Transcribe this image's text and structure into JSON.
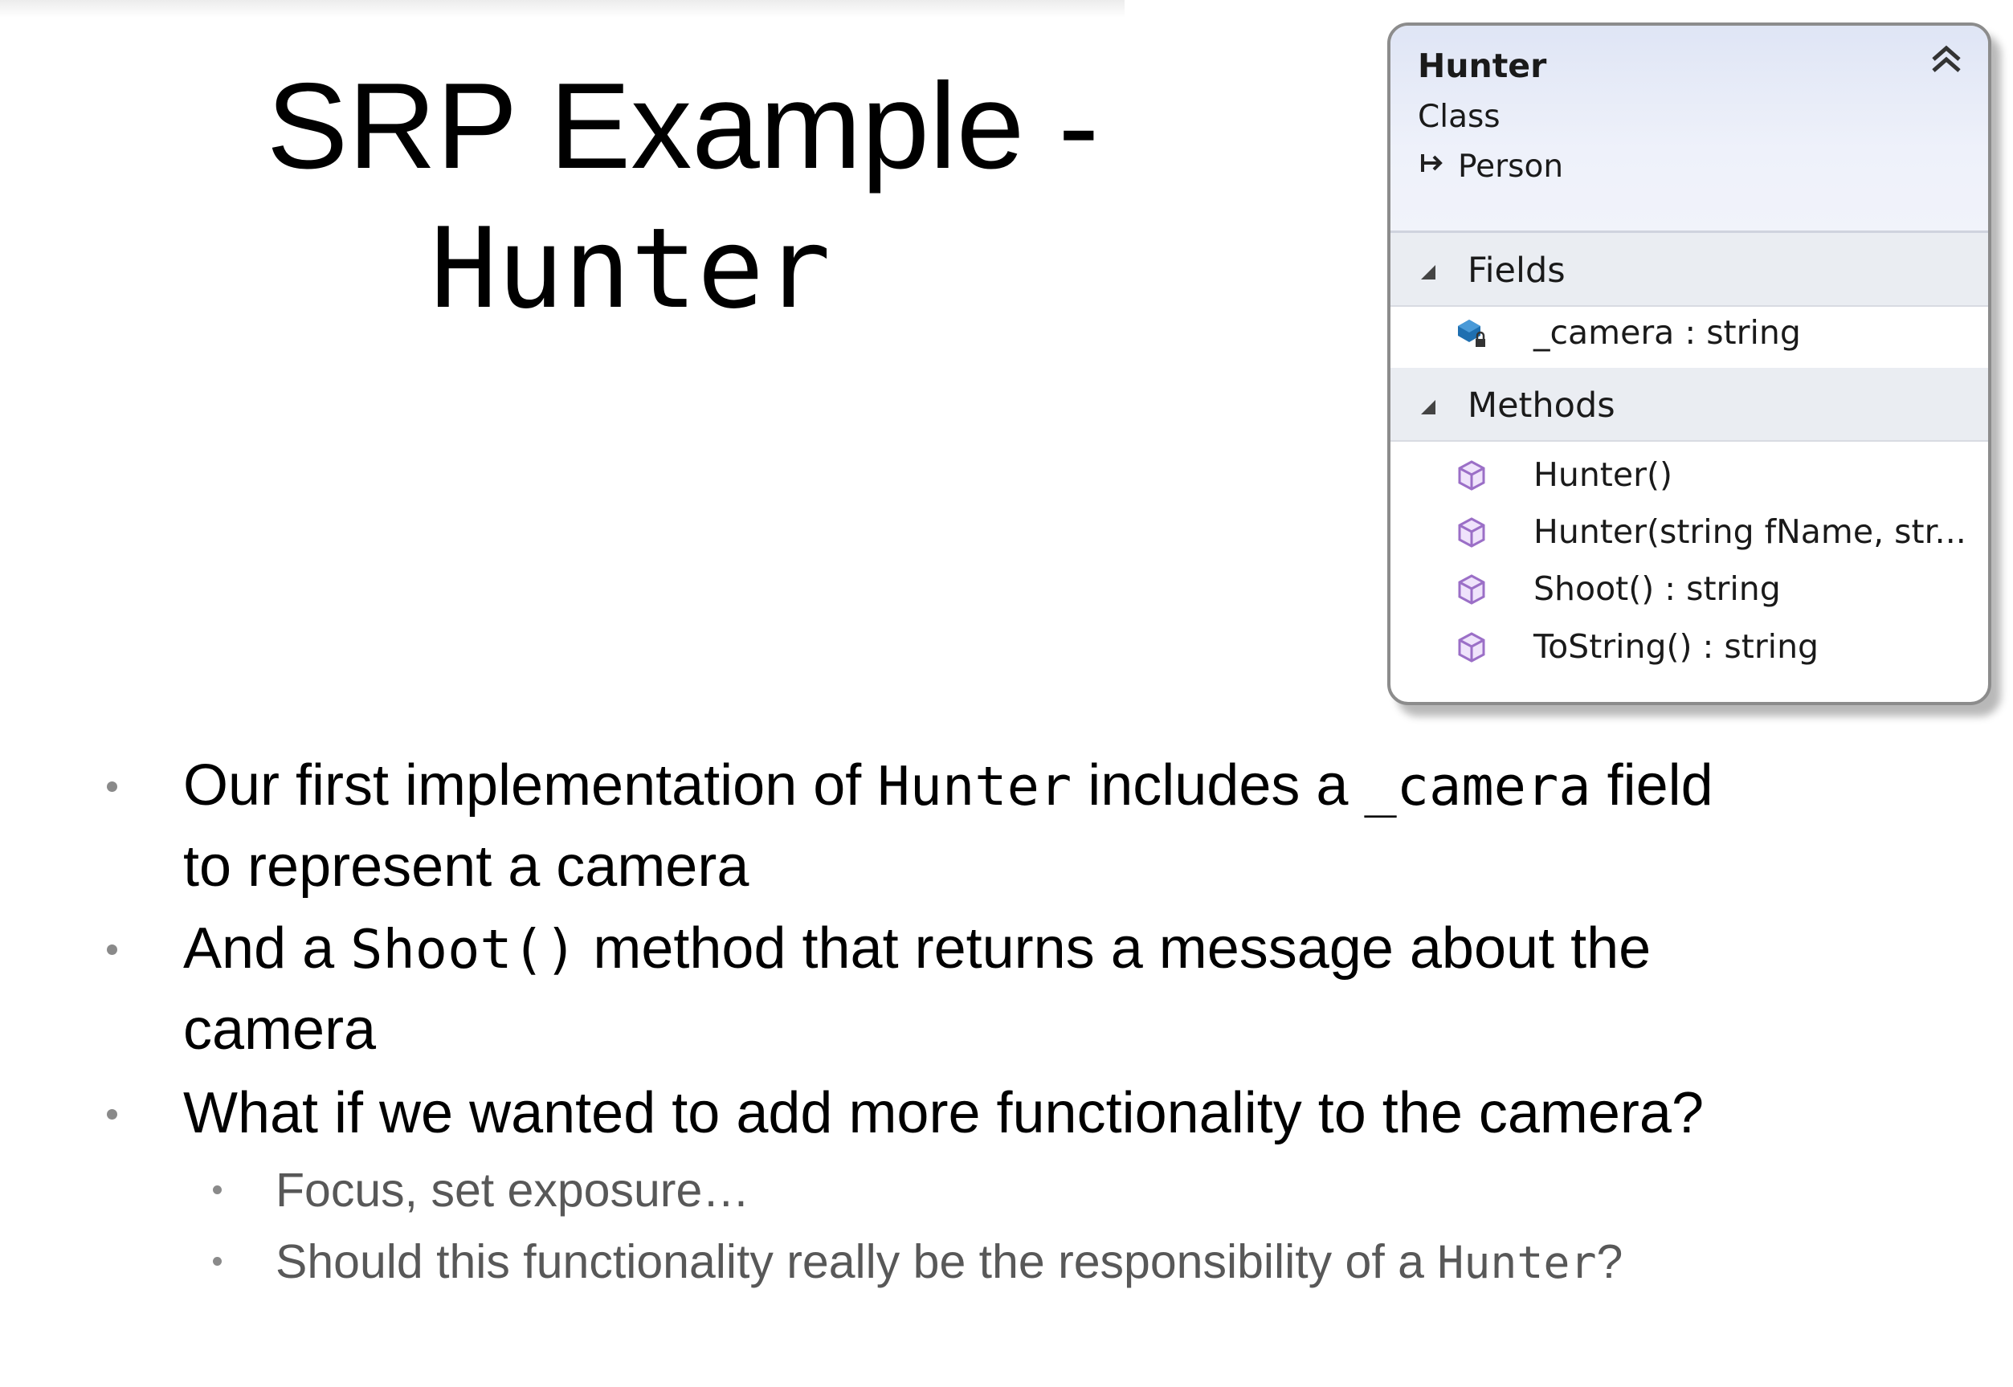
{
  "slide": {
    "title_line1": "SRP Example -",
    "title_line2": "Hunter"
  },
  "class_diagram": {
    "name": "Hunter",
    "kind": "Class",
    "base_class": "Person",
    "sections": {
      "fields_label": "Fields",
      "methods_label": "Methods"
    },
    "fields": [
      {
        "text": "_camera : string",
        "icon": "private-field-icon"
      }
    ],
    "methods": [
      {
        "text": "Hunter()",
        "icon": "method-icon"
      },
      {
        "text": "Hunter(string  fName,  str...",
        "icon": "method-icon"
      },
      {
        "text": "Shoot() : string",
        "icon": "method-icon"
      },
      {
        "text": "ToString() : string",
        "icon": "method-icon"
      }
    ],
    "colors": {
      "header_top": "#dfe5f5",
      "section_bg": "#eaedf2",
      "method_icon": "#9b6fc7",
      "field_icon": "#1f6fb0"
    }
  },
  "bullets": [
    {
      "p1": "Our first implementation of ",
      "c1": "Hunter",
      "p2": " includes a ",
      "c2": "_camera",
      "p3": " field",
      "line2": "to represent a camera"
    },
    {
      "p1": "And a ",
      "c1": "Shoot()",
      "p2": " method that returns a message about the",
      "line2": "camera"
    },
    {
      "text": "What if we wanted to add more functionality to the camera?"
    }
  ],
  "sub_bullets": [
    {
      "text": "Focus, set exposure…"
    },
    {
      "p1": "Should this functionality really be the responsibility of a ",
      "c1": "Hunter",
      "p2": "?"
    }
  ]
}
